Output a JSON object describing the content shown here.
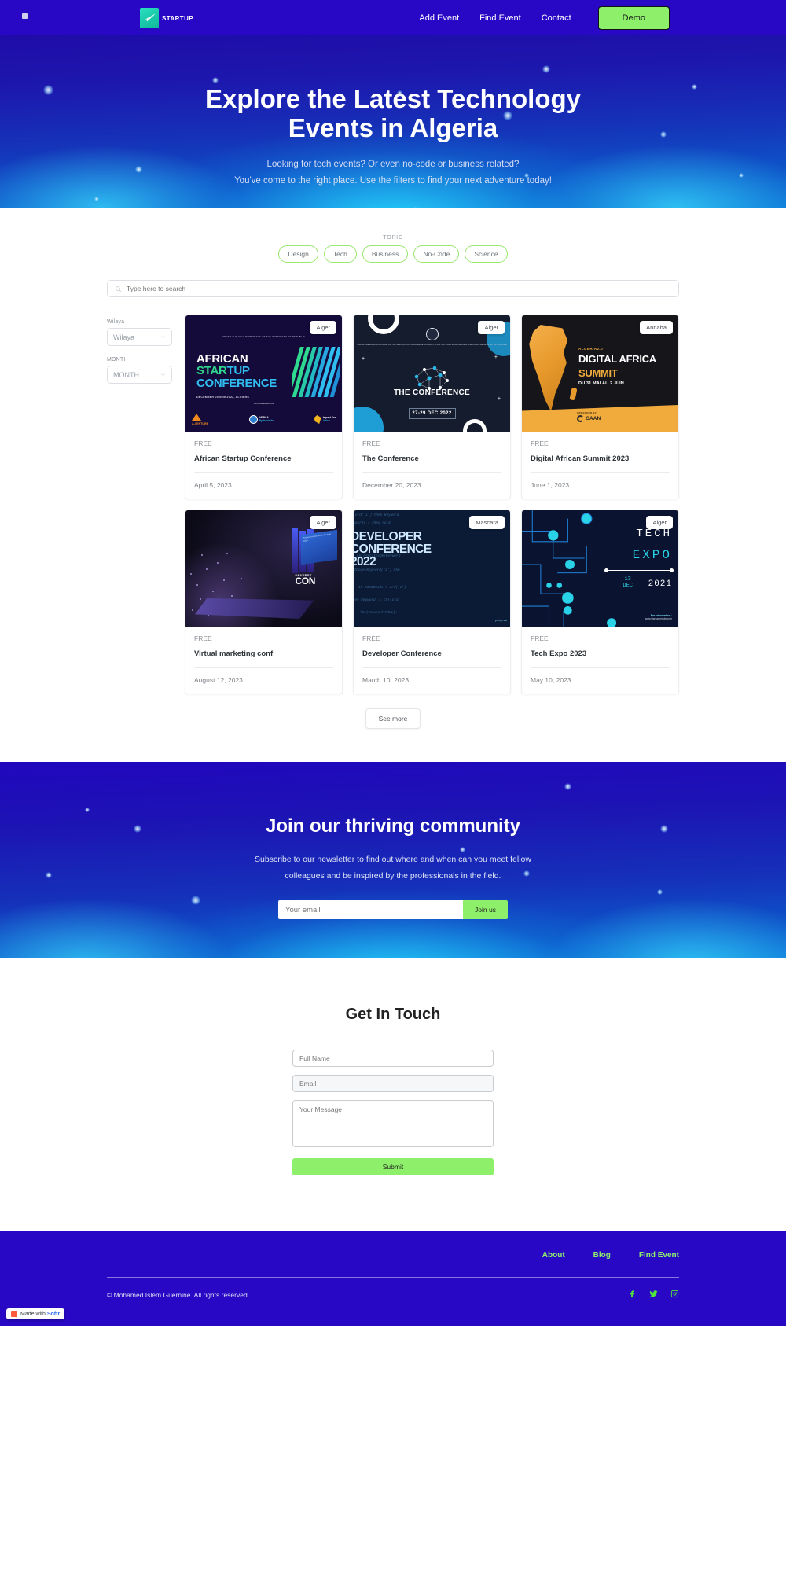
{
  "header": {
    "logo_text": "STARTUP",
    "logo_icon": "paper-plane-icon",
    "nav": [
      {
        "label": "Add Event"
      },
      {
        "label": "Find Event"
      },
      {
        "label": "Contact"
      }
    ],
    "demo_button": "Demo"
  },
  "hero": {
    "title_line1": "Explore the Latest Technology",
    "title_line2": "Events in Algeria",
    "sub_line1": "Looking for tech events? Or even no-code or business related?",
    "sub_line2": "You've come to the right place. Use the filters to find your next adventure today!"
  },
  "filters": {
    "topic_label": "TOPIC",
    "topics": [
      "Design",
      "Tech",
      "Business",
      "No-Code",
      "Science"
    ],
    "search_placeholder": "Type here to search",
    "search_value": "",
    "search_icon": "search-icon",
    "wilaya_label": "Wilaya",
    "wilaya_value": "Wilaya",
    "month_label": "MONTH",
    "month_value": "MONTH"
  },
  "events": [
    {
      "city": "Alger",
      "price": "FREE",
      "title": "African Startup Conference",
      "date": "April 5, 2023",
      "poster": {
        "patronage": "UNDER THE HIGH PATRONAGE OF THE PRESIDENT OF REPUBLIC",
        "l1": "AFRICAN",
        "l2a": "STAR",
        "l2b": "TUP",
        "l3": "CONFERENCE",
        "date": "DECEMBER 05-06th 2022, ALGIERS",
        "colocated": "Co-Located Events",
        "sponsor1": "A-VENTURE",
        "sponsor2a": "AFRICA",
        "sponsor2b": "By Incubsto",
        "sponsor3a": "Impact For",
        "sponsor3b": "Africa"
      }
    },
    {
      "city": "Alger",
      "price": "FREE",
      "title": "The Conference",
      "date": "December 20, 2023",
      "poster": {
        "patronage": "UNDER THE HIGH PATRONAGE OF THE MINISTRY OF KNOWLEDGE ECONOMY, START-UPS AND MICRO-ENTERPRISES AND THE MINISTRY OF CULTURE",
        "title": "THE CONFERENCE",
        "date": "27-29 DEC 2022"
      }
    },
    {
      "city": "Annaba",
      "price": "FREE",
      "title": "Digital African Summit 2023",
      "date": "June 1, 2023",
      "poster": {
        "sup": "ALGERIA2.0",
        "t1": "DIGITAL AFRICA",
        "t2": "SUMMIT",
        "t3": "DU 31 MAI AU 2 JUIN",
        "org_label": "ORGANIZED BY",
        "org_name": "GAAN"
      }
    },
    {
      "city": "Alger",
      "price": "FREE",
      "title": "Virtual marketing conf",
      "date": "August 12, 2023",
      "poster": {
        "logo_small": "DEVFEST",
        "logo_big": "CON",
        "screen_text": "Keynote session live on the main stage"
      }
    },
    {
      "city": "Mascara",
      "price": "FREE",
      "title": "Developer Conference",
      "date": "March 10, 2023",
      "poster": {
        "l1": "DEVELOPER",
        "l2": "CONFERENCE",
        "l3": "2022",
        "code_line": "If (ASCIICode+Keyword('z') then",
        "footer": "program"
      }
    },
    {
      "city": "Alger",
      "price": "FREE",
      "title": "Tech Expo 2023",
      "date": "May 10, 2023",
      "poster": {
        "t1": "TECH",
        "t2": "EXPO",
        "day": "13",
        "month": "DEC",
        "year": "2021",
        "info_label": "For information :",
        "info_url": "www.startupremote.com"
      }
    }
  ],
  "see_more": "See more",
  "community": {
    "title": "Join our thriving community",
    "sub_line1": "Subscribe to our newsletter to find out where and when can you meet fellow",
    "sub_line2": "colleagues and be inspired by the professionals in the field.",
    "email_placeholder": "Your email",
    "email_value": "",
    "join_button": "Join us"
  },
  "contact": {
    "title": "Get In Touch",
    "name_placeholder": "Full Name",
    "name_value": "",
    "email_placeholder": "Email",
    "email_value": "",
    "message_placeholder": "Your Message",
    "message_value": "",
    "submit_button": "Submit"
  },
  "footer": {
    "links": [
      {
        "label": "About"
      },
      {
        "label": "Blog"
      },
      {
        "label": "Find Event"
      }
    ],
    "copyright": "© Mohamed Islem Guernine. All rights reserved.",
    "socials": [
      "facebook-icon",
      "twitter-icon",
      "instagram-icon"
    ],
    "badge_prefix": "Made with ",
    "badge_brand": "Softr"
  },
  "colors": {
    "brand_blue": "#2808c4",
    "accent_green": "#8ef06a",
    "chip_border": "#9ae86f",
    "footer_link": "#8ef06a"
  }
}
